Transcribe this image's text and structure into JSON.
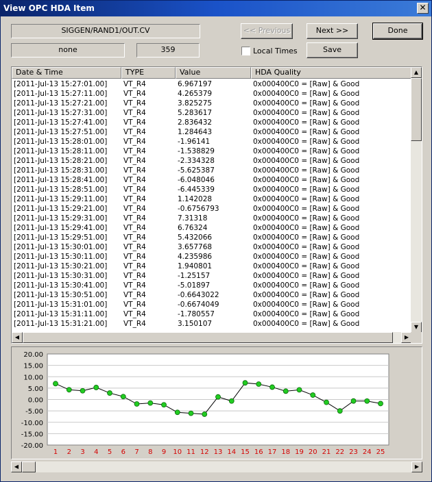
{
  "window": {
    "title": "View OPC HDA Item",
    "close_glyph": "✕"
  },
  "item": {
    "path": "SIGGEN/RAND1/OUT.CV",
    "aggregate": "none",
    "count": "359"
  },
  "buttons": {
    "previous": "<< Previous",
    "next": "Next >>",
    "done": "Done",
    "save": "Save"
  },
  "local_times": {
    "label": "Local Times",
    "checked": false
  },
  "table": {
    "columns": [
      "Date & Time",
      "TYPE",
      "Value",
      "HDA Quality"
    ],
    "rows": [
      [
        "[2011-Jul-13  15:27:01.00]",
        "VT_R4",
        "6.967197",
        "0x000400C0 = [Raw] & Good"
      ],
      [
        "[2011-Jul-13  15:27:11.00]",
        "VT_R4",
        "4.265379",
        "0x000400C0 = [Raw] & Good"
      ],
      [
        "[2011-Jul-13  15:27:21.00]",
        "VT_R4",
        "3.825275",
        "0x000400C0 = [Raw] & Good"
      ],
      [
        "[2011-Jul-13  15:27:31.00]",
        "VT_R4",
        "5.283617",
        "0x000400C0 = [Raw] & Good"
      ],
      [
        "[2011-Jul-13  15:27:41.00]",
        "VT_R4",
        "2.836432",
        "0x000400C0 = [Raw] & Good"
      ],
      [
        "[2011-Jul-13  15:27:51.00]",
        "VT_R4",
        "1.284643",
        "0x000400C0 = [Raw] & Good"
      ],
      [
        "[2011-Jul-13  15:28:01.00]",
        "VT_R4",
        "-1.96141",
        "0x000400C0 = [Raw] & Good"
      ],
      [
        "[2011-Jul-13  15:28:11.00]",
        "VT_R4",
        "-1.538829",
        "0x000400C0 = [Raw] & Good"
      ],
      [
        "[2011-Jul-13  15:28:21.00]",
        "VT_R4",
        "-2.334328",
        "0x000400C0 = [Raw] & Good"
      ],
      [
        "[2011-Jul-13  15:28:31.00]",
        "VT_R4",
        "-5.625387",
        "0x000400C0 = [Raw] & Good"
      ],
      [
        "[2011-Jul-13  15:28:41.00]",
        "VT_R4",
        "-6.048046",
        "0x000400C0 = [Raw] & Good"
      ],
      [
        "[2011-Jul-13  15:28:51.00]",
        "VT_R4",
        "-6.445339",
        "0x000400C0 = [Raw] & Good"
      ],
      [
        "[2011-Jul-13  15:29:11.00]",
        "VT_R4",
        "1.142028",
        "0x000400C0 = [Raw] & Good"
      ],
      [
        "[2011-Jul-13  15:29:21.00]",
        "VT_R4",
        "-0.6756793",
        "0x000400C0 = [Raw] & Good"
      ],
      [
        "[2011-Jul-13  15:29:31.00]",
        "VT_R4",
        "7.31318",
        "0x000400C0 = [Raw] & Good"
      ],
      [
        "[2011-Jul-13  15:29:41.00]",
        "VT_R4",
        "6.76324",
        "0x000400C0 = [Raw] & Good"
      ],
      [
        "[2011-Jul-13  15:29:51.00]",
        "VT_R4",
        "5.432066",
        "0x000400C0 = [Raw] & Good"
      ],
      [
        "[2011-Jul-13  15:30:01.00]",
        "VT_R4",
        "3.657768",
        "0x000400C0 = [Raw] & Good"
      ],
      [
        "[2011-Jul-13  15:30:11.00]",
        "VT_R4",
        "4.235986",
        "0x000400C0 = [Raw] & Good"
      ],
      [
        "[2011-Jul-13  15:30:21.00]",
        "VT_R4",
        "1.940801",
        "0x000400C0 = [Raw] & Good"
      ],
      [
        "[2011-Jul-13  15:30:31.00]",
        "VT_R4",
        "-1.25157",
        "0x000400C0 = [Raw] & Good"
      ],
      [
        "[2011-Jul-13  15:30:41.00]",
        "VT_R4",
        "-5.01897",
        "0x000400C0 = [Raw] & Good"
      ],
      [
        "[2011-Jul-13  15:30:51.00]",
        "VT_R4",
        "-0.6643022",
        "0x000400C0 = [Raw] & Good"
      ],
      [
        "[2011-Jul-13  15:31:01.00]",
        "VT_R4",
        "-0.6674049",
        "0x000400C0 = [Raw] & Good"
      ],
      [
        "[2011-Jul-13  15:31:11.00]",
        "VT_R4",
        "-1.780557",
        "0x000400C0 = [Raw] & Good"
      ],
      [
        "[2011-Jul-13  15:31:21.00]",
        "VT_R4",
        "3.150107",
        "0x000400C0 = [Raw] & Good"
      ]
    ]
  },
  "scroll_icons": {
    "up": "▲",
    "down": "▼",
    "left": "◀",
    "right": "▶"
  },
  "colors": {
    "line": "#000000",
    "marker": "#22cc22",
    "x_tick": "#d40000",
    "grid": "#c8c8c8",
    "plot_bg": "#ffffff"
  },
  "chart_data": {
    "type": "line",
    "title": "",
    "xlabel": "",
    "ylabel": "",
    "ylim": [
      -20,
      20
    ],
    "y_ticks": [
      "20.00",
      "15.00",
      "10.00",
      "5.00",
      "0.00",
      "-5.00",
      "-10.00",
      "-15.00",
      "-20.00"
    ],
    "categories": [
      "1",
      "2",
      "3",
      "4",
      "5",
      "6",
      "7",
      "8",
      "9",
      "10",
      "11",
      "12",
      "13",
      "14",
      "15",
      "16",
      "17",
      "18",
      "19",
      "20",
      "21",
      "22",
      "23",
      "24",
      "25"
    ],
    "values": [
      6.97,
      4.27,
      3.83,
      5.28,
      2.84,
      1.28,
      -1.96,
      -1.54,
      -2.33,
      -5.63,
      -6.05,
      -6.45,
      1.14,
      -0.68,
      7.31,
      6.76,
      5.43,
      3.66,
      4.24,
      1.94,
      -1.25,
      -5.02,
      -0.66,
      -0.67,
      -1.78
    ],
    "grid": true,
    "legend": "none"
  }
}
